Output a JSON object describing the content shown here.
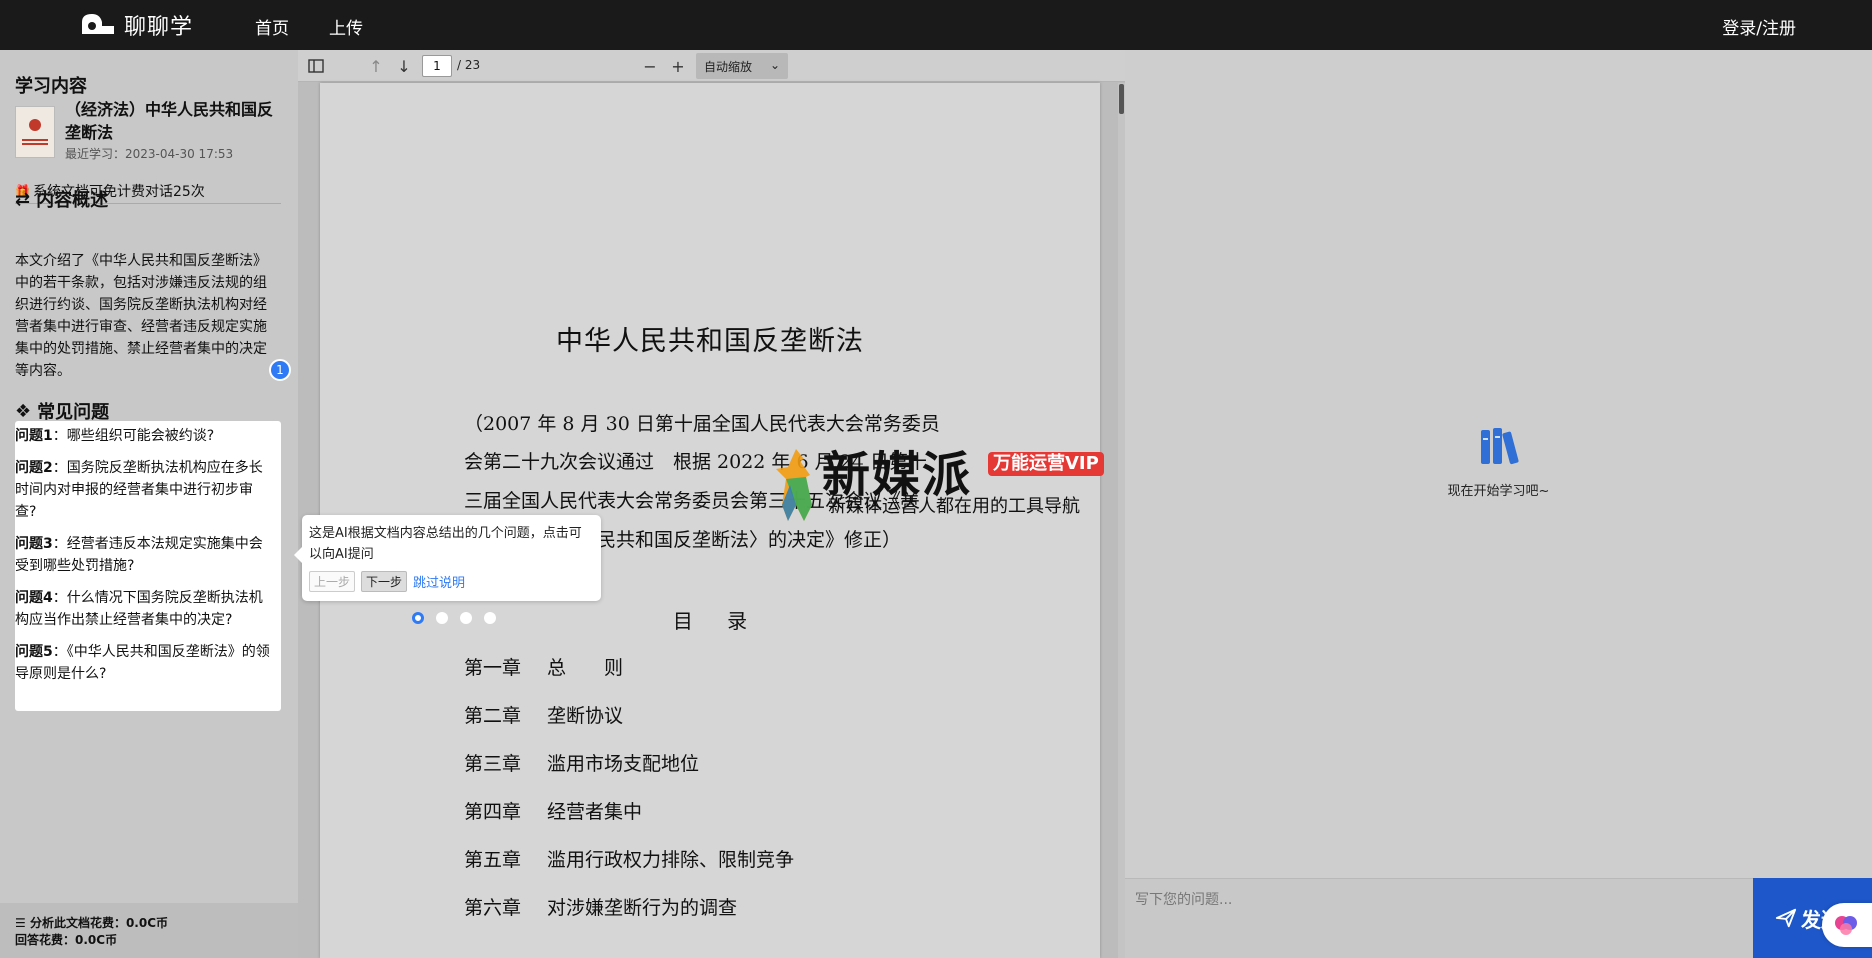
{
  "topbar": {
    "logo_text": "聊聊学",
    "nav": [
      "首页",
      "上传"
    ],
    "login": "登录/注册"
  },
  "left": {
    "section_title": "学习内容",
    "doc_name": "（经济法）中华人民共和国反垄断法",
    "doc_recent": "最近学习：2023-04-30 17:53",
    "free_tip": "系统文档可免计费对话25次",
    "summary_title": "内容概述",
    "summary_text": "本文介绍了《中华人民共和国反垄断法》中的若干条款，包括对涉嫌违反法规的组织进行约谈、国务院反垄断执法机构对经营者集中进行审查、经营者违反规定实施集中的处罚措施、禁止经营者集中的决定等内容。",
    "faq_title": "常见问题",
    "step_badge": "1",
    "questions": [
      {
        "label": "问题1",
        "text": "哪些组织可能会被约谈?"
      },
      {
        "label": "问题2",
        "text": "国务院反垄断执法机构应在多长时间内对申报的经营者集中进行初步审查?"
      },
      {
        "label": "问题3",
        "text": "经营者违反本法规定实施集中会受到哪些处罚措施?"
      },
      {
        "label": "问题4",
        "text": "什么情况下国务院反垄断执法机构应当作出禁止经营者集中的决定?"
      },
      {
        "label": "问题5",
        "text": "《中华人民共和国反垄断法》的领导原则是什么?"
      }
    ],
    "cost_analysis": "分析此文档花费：0.0C币",
    "cost_qa": "回答花费：0.0C币"
  },
  "viewer": {
    "page_current": "1",
    "page_total": "/ 23",
    "zoom": "自动缩放",
    "doc": {
      "title": "中华人民共和国反垄断法",
      "preface": [
        "（2007 年 8 月 30 日第十届全国人民代表大会常务委员",
        "会第二十九次会议通过　根据 2022 年 6 月 24 日第十",
        "三届全国人民代表大会常务委员会第三十五次会议《关",
        "于修改〈中华人民共和国反垄断法〉的决定》修正）"
      ],
      "toc_heading": "目 录",
      "toc": [
        {
          "ch": "第一章",
          "name": "总　　则"
        },
        {
          "ch": "第二章",
          "name": "垄断协议"
        },
        {
          "ch": "第三章",
          "name": "滥用市场支配地位"
        },
        {
          "ch": "第四章",
          "name": "经营者集中"
        },
        {
          "ch": "第五章",
          "name": "滥用行政权力排除、限制竞争"
        },
        {
          "ch": "第六章",
          "name": "对涉嫌垄断行为的调查"
        }
      ]
    }
  },
  "guide": {
    "text": "这是AI根据文档内容总结出的几个问题，点击可以向AI提问",
    "prev": "上一步",
    "next": "下一步",
    "skip": "跳过说明"
  },
  "watermark": {
    "title": "新媒派",
    "vip": "万能运营VIP",
    "subtitle": "新媒体运营人都在用的工具导航"
  },
  "right": {
    "empty_text": "现在开始学习吧~",
    "input_placeholder": "写下您的问题...",
    "send_label": "发送"
  },
  "colors": {
    "accent": "#2f7bf5",
    "send": "#1d57c9",
    "topbar": "#1a1a1a"
  }
}
